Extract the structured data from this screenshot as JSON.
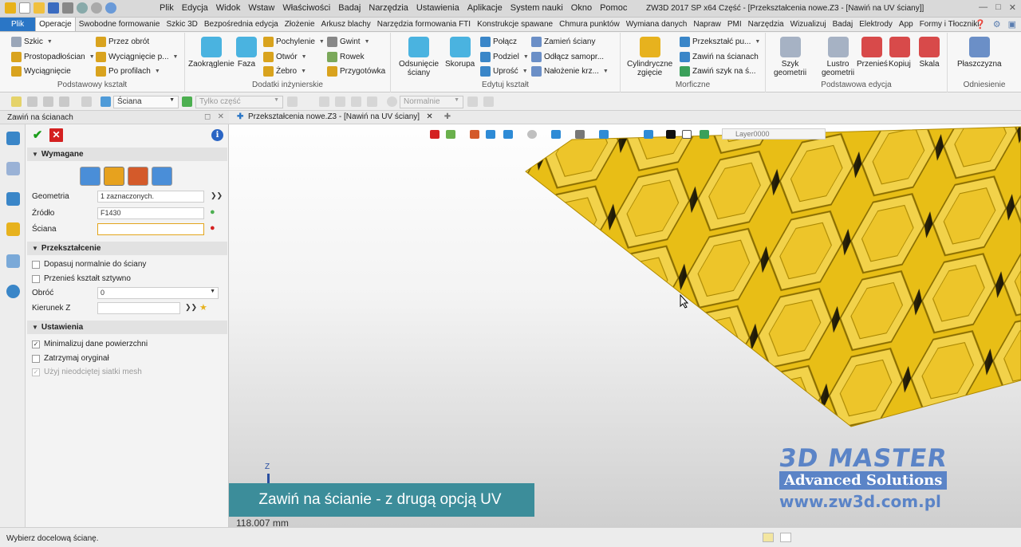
{
  "titlebar": {
    "menu": [
      "Plik",
      "Edycja",
      "Widok",
      "Wstaw",
      "Właściwości",
      "Badaj",
      "Narzędzia",
      "Ustawienia",
      "Aplikacje",
      "System nauki",
      "Okno",
      "Pomoc"
    ],
    "window_title": "ZW3D 2017 SP x64          Część - [Przekształcenia nowe.Z3 - [Nawiń na UV ściany]]"
  },
  "ribbon_tabs": {
    "file": "Plik",
    "items": [
      "Operacje",
      "Swobodne formowanie",
      "Szkic 3D",
      "Bezpośrednia edycja",
      "Złożenie",
      "Arkusz blachy",
      "Narzędzia formowania FTI",
      "Konstrukcje spawane",
      "Chmura punktów",
      "Wymiana danych",
      "Napraw",
      "PMI",
      "Narzędzia",
      "Wizualizuj",
      "Badaj",
      "Elektrody",
      "App",
      "Formy i Tłoczniki"
    ]
  },
  "ribbon": {
    "podstawowy": {
      "label": "Podstawowy kształt",
      "szkic": "Szkic",
      "przez_obrot": "Przez obrót",
      "prostopadloscian": "Prostopadłościan",
      "wyciagniecie_p": "Wyciągnięcie p...",
      "wyciagniecie": "Wyciągnięcie",
      "po_profilach": "Po profilach"
    },
    "dodatki": {
      "label": "Dodatki inżynierskie",
      "zaokraglenie": "Zaokrąglenie",
      "faza": "Faza",
      "pochylenie": "Pochylenie",
      "otwor": "Otwór",
      "zebro": "Żebro",
      "gwint": "Gwint",
      "rowek": "Rowek",
      "przygotowka": "Przygotówka"
    },
    "edytuj": {
      "label": "Edytuj kształt",
      "odsuniecie_1": "Odsunięcie",
      "odsuniecie_2": "ściany",
      "skorupa": "Skorupa",
      "polacz": "Połącz",
      "podziel": "Podziel",
      "uprosc": "Uprość",
      "zamien": "Zamień ściany",
      "odlacz": "Odłącz samopr...",
      "nalozenie": "Nałożenie krz..."
    },
    "morficzne": {
      "label": "Morficzne",
      "cyl_1": "Cylindryczne",
      "cyl_2": "zgięcie",
      "przeksztalc": "Przekształć pu...",
      "zawin": "Zawiń na ścianach",
      "zawin_szyk": "Zawiń szyk na ś..."
    },
    "edycja": {
      "label": "Podstawowa edycja",
      "szyk_1": "Szyk",
      "szyk_2": "geometrii",
      "lustro_1": "Lustro",
      "lustro_2": "geometrii",
      "przenies": "Przenieś",
      "kopiuj": "Kopiuj",
      "skala": "Skala"
    },
    "odniesienie": {
      "label": "Odniesienie",
      "plaszczyzna": "Płaszczyzna"
    }
  },
  "toolbar": {
    "filter": "Ściana",
    "scope": "Tylko część",
    "normal": "Normalnie"
  },
  "panel": {
    "title": "Zawiń na ścianach",
    "sec_required": "Wymagane",
    "geometria_label": "Geometria",
    "geometria_value": "1 zaznaczonych.",
    "zrodlo_label": "Źródło",
    "zrodlo_value": "F1430",
    "sciana_label": "Ściana",
    "sciana_value": "",
    "sec_transform": "Przekształcenie",
    "dopasuj": "Dopasuj normalnie do ściany",
    "przenies": "Przenieś kształt sztywno",
    "obroc_label": "Obróć",
    "obroc_value": "0",
    "kierunek_label": "Kierunek Z",
    "sec_settings": "Ustawienia",
    "minimalizuj": "Minimalizuj dane powierzchni",
    "zatrzymaj": "Zatrzymaj oryginał",
    "uzyj": "Użyj nieodciętej siatki mesh"
  },
  "viewport": {
    "tab": "Przekształcenia nowe.Z3 - [Nawiń na UV ściany]",
    "layer": "Layer0000",
    "axis": "Z",
    "caption": "Zawiń na ścianie - z drugą opcją UV",
    "measure": "118.007 mm",
    "logo_line1": "3D MASTER",
    "logo_line2": "Advanced Solutions",
    "logo_line3": "www.zw3d.com.pl"
  },
  "status": {
    "prompt": "Wybierz docelową ścianę."
  },
  "colors": {
    "honeycomb": "#e6b800",
    "accent": "#2a76c6",
    "caption_bg": "#3c8d9a",
    "logo": "#5b84c7"
  }
}
